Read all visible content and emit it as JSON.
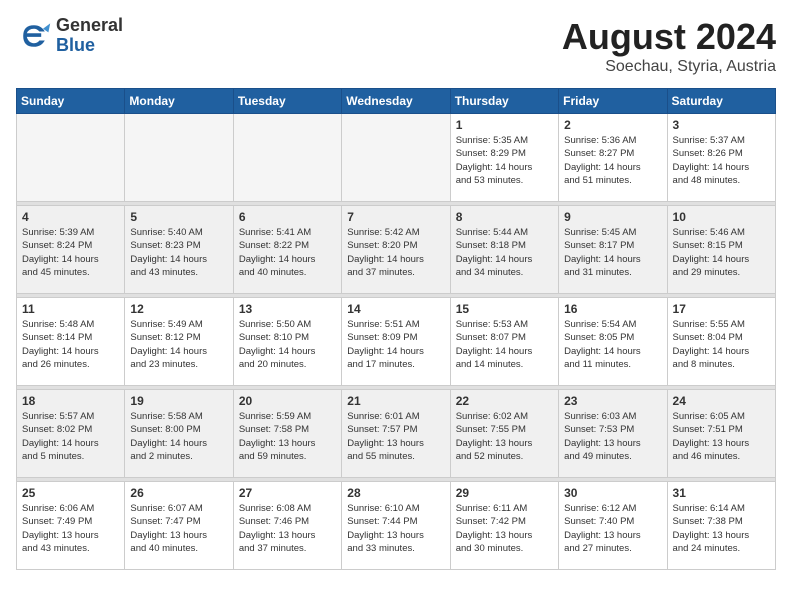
{
  "header": {
    "logo_general": "General",
    "logo_blue": "Blue",
    "month_title": "August 2024",
    "location": "Soechau, Styria, Austria"
  },
  "days_of_week": [
    "Sunday",
    "Monday",
    "Tuesday",
    "Wednesday",
    "Thursday",
    "Friday",
    "Saturday"
  ],
  "weeks": [
    [
      {
        "day": "",
        "info": "",
        "empty": true
      },
      {
        "day": "",
        "info": "",
        "empty": true
      },
      {
        "day": "",
        "info": "",
        "empty": true
      },
      {
        "day": "",
        "info": "",
        "empty": true
      },
      {
        "day": "1",
        "info": "Sunrise: 5:35 AM\nSunset: 8:29 PM\nDaylight: 14 hours\nand 53 minutes."
      },
      {
        "day": "2",
        "info": "Sunrise: 5:36 AM\nSunset: 8:27 PM\nDaylight: 14 hours\nand 51 minutes."
      },
      {
        "day": "3",
        "info": "Sunrise: 5:37 AM\nSunset: 8:26 PM\nDaylight: 14 hours\nand 48 minutes."
      }
    ],
    [
      {
        "day": "4",
        "info": "Sunrise: 5:39 AM\nSunset: 8:24 PM\nDaylight: 14 hours\nand 45 minutes."
      },
      {
        "day": "5",
        "info": "Sunrise: 5:40 AM\nSunset: 8:23 PM\nDaylight: 14 hours\nand 43 minutes."
      },
      {
        "day": "6",
        "info": "Sunrise: 5:41 AM\nSunset: 8:22 PM\nDaylight: 14 hours\nand 40 minutes."
      },
      {
        "day": "7",
        "info": "Sunrise: 5:42 AM\nSunset: 8:20 PM\nDaylight: 14 hours\nand 37 minutes."
      },
      {
        "day": "8",
        "info": "Sunrise: 5:44 AM\nSunset: 8:18 PM\nDaylight: 14 hours\nand 34 minutes."
      },
      {
        "day": "9",
        "info": "Sunrise: 5:45 AM\nSunset: 8:17 PM\nDaylight: 14 hours\nand 31 minutes."
      },
      {
        "day": "10",
        "info": "Sunrise: 5:46 AM\nSunset: 8:15 PM\nDaylight: 14 hours\nand 29 minutes."
      }
    ],
    [
      {
        "day": "11",
        "info": "Sunrise: 5:48 AM\nSunset: 8:14 PM\nDaylight: 14 hours\nand 26 minutes."
      },
      {
        "day": "12",
        "info": "Sunrise: 5:49 AM\nSunset: 8:12 PM\nDaylight: 14 hours\nand 23 minutes."
      },
      {
        "day": "13",
        "info": "Sunrise: 5:50 AM\nSunset: 8:10 PM\nDaylight: 14 hours\nand 20 minutes."
      },
      {
        "day": "14",
        "info": "Sunrise: 5:51 AM\nSunset: 8:09 PM\nDaylight: 14 hours\nand 17 minutes."
      },
      {
        "day": "15",
        "info": "Sunrise: 5:53 AM\nSunset: 8:07 PM\nDaylight: 14 hours\nand 14 minutes."
      },
      {
        "day": "16",
        "info": "Sunrise: 5:54 AM\nSunset: 8:05 PM\nDaylight: 14 hours\nand 11 minutes."
      },
      {
        "day": "17",
        "info": "Sunrise: 5:55 AM\nSunset: 8:04 PM\nDaylight: 14 hours\nand 8 minutes."
      }
    ],
    [
      {
        "day": "18",
        "info": "Sunrise: 5:57 AM\nSunset: 8:02 PM\nDaylight: 14 hours\nand 5 minutes."
      },
      {
        "day": "19",
        "info": "Sunrise: 5:58 AM\nSunset: 8:00 PM\nDaylight: 14 hours\nand 2 minutes."
      },
      {
        "day": "20",
        "info": "Sunrise: 5:59 AM\nSunset: 7:58 PM\nDaylight: 13 hours\nand 59 minutes."
      },
      {
        "day": "21",
        "info": "Sunrise: 6:01 AM\nSunset: 7:57 PM\nDaylight: 13 hours\nand 55 minutes."
      },
      {
        "day": "22",
        "info": "Sunrise: 6:02 AM\nSunset: 7:55 PM\nDaylight: 13 hours\nand 52 minutes."
      },
      {
        "day": "23",
        "info": "Sunrise: 6:03 AM\nSunset: 7:53 PM\nDaylight: 13 hours\nand 49 minutes."
      },
      {
        "day": "24",
        "info": "Sunrise: 6:05 AM\nSunset: 7:51 PM\nDaylight: 13 hours\nand 46 minutes."
      }
    ],
    [
      {
        "day": "25",
        "info": "Sunrise: 6:06 AM\nSunset: 7:49 PM\nDaylight: 13 hours\nand 43 minutes."
      },
      {
        "day": "26",
        "info": "Sunrise: 6:07 AM\nSunset: 7:47 PM\nDaylight: 13 hours\nand 40 minutes."
      },
      {
        "day": "27",
        "info": "Sunrise: 6:08 AM\nSunset: 7:46 PM\nDaylight: 13 hours\nand 37 minutes."
      },
      {
        "day": "28",
        "info": "Sunrise: 6:10 AM\nSunset: 7:44 PM\nDaylight: 13 hours\nand 33 minutes."
      },
      {
        "day": "29",
        "info": "Sunrise: 6:11 AM\nSunset: 7:42 PM\nDaylight: 13 hours\nand 30 minutes."
      },
      {
        "day": "30",
        "info": "Sunrise: 6:12 AM\nSunset: 7:40 PM\nDaylight: 13 hours\nand 27 minutes."
      },
      {
        "day": "31",
        "info": "Sunrise: 6:14 AM\nSunset: 7:38 PM\nDaylight: 13 hours\nand 24 minutes."
      }
    ]
  ]
}
